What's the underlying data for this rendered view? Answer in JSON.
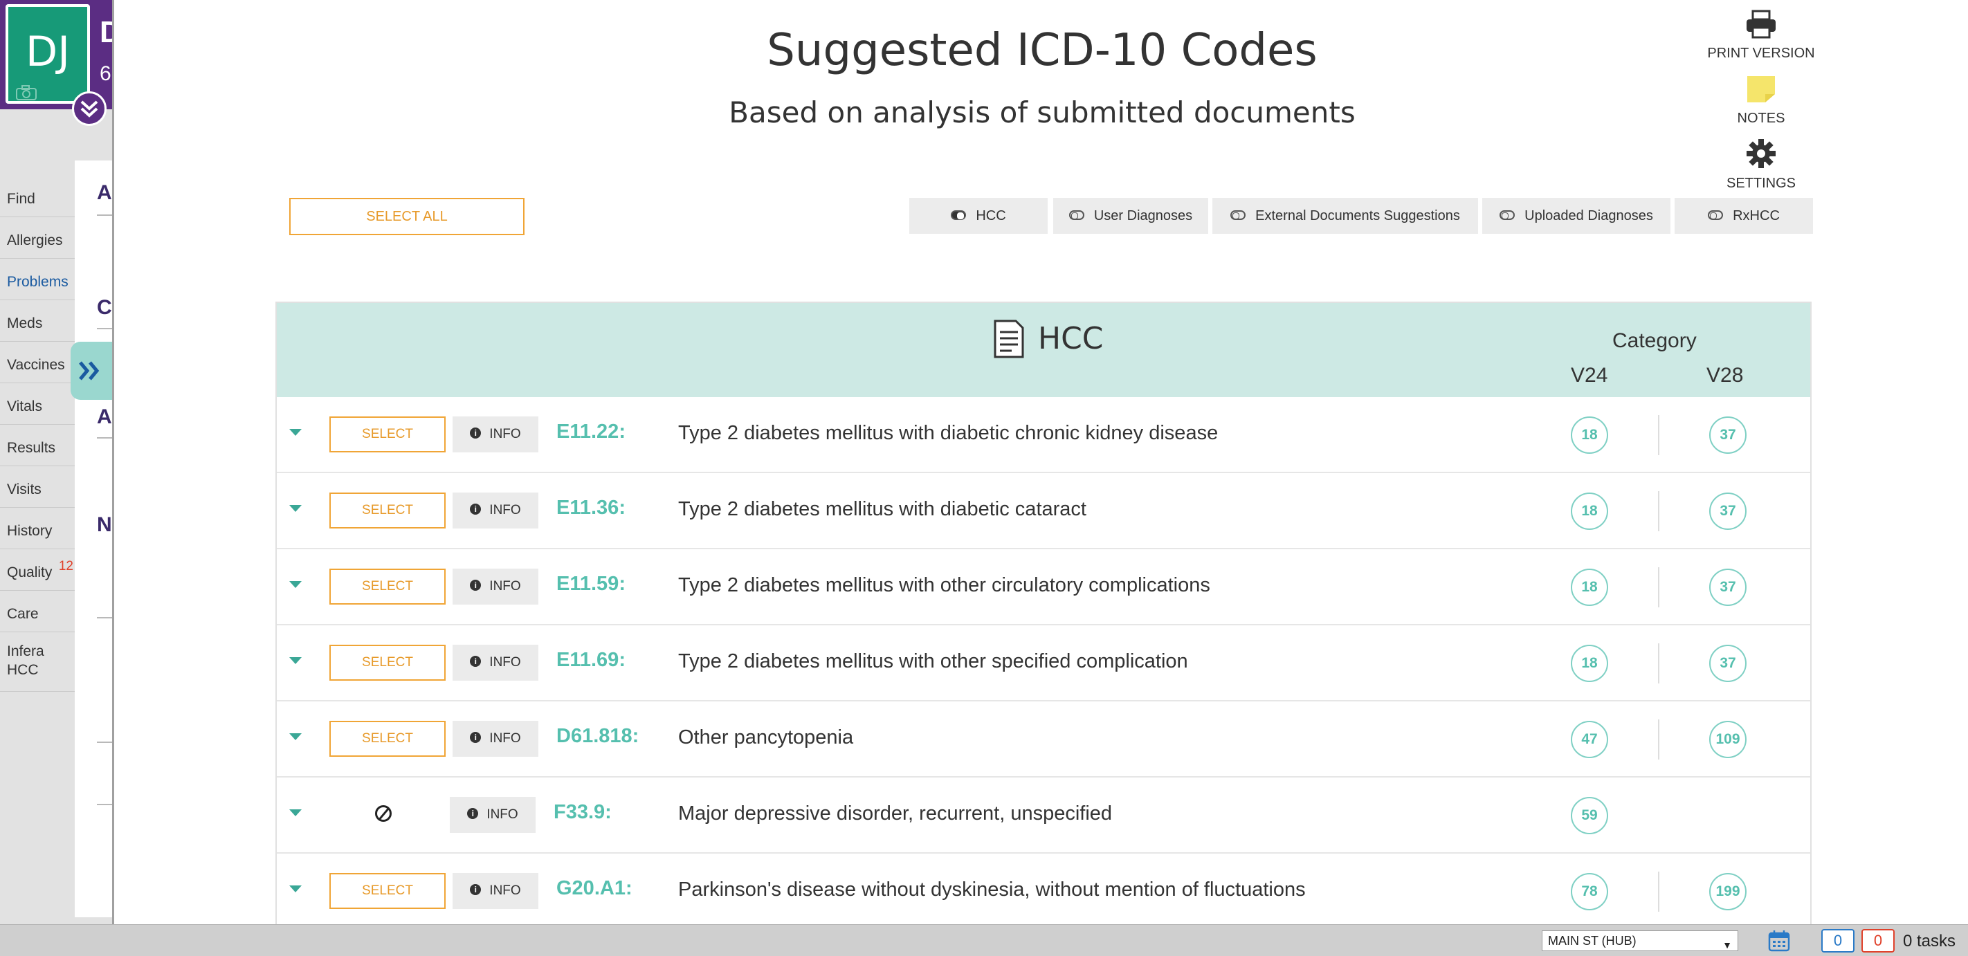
{
  "patient": {
    "initials": "DJ",
    "name_partial": "D",
    "sub_partial": "6"
  },
  "nav": {
    "items": [
      {
        "label": "Find"
      },
      {
        "label": "Allergies"
      },
      {
        "label": "Problems"
      },
      {
        "label": "Meds"
      },
      {
        "label": "Vaccines"
      },
      {
        "label": "Vitals"
      },
      {
        "label": "Results"
      },
      {
        "label": "Visits"
      },
      {
        "label": "History"
      },
      {
        "label": "Quality",
        "badge": "12"
      },
      {
        "label": "Care"
      },
      {
        "label": "Infera HCC"
      }
    ],
    "underlay_glyphs": [
      "A",
      "C",
      "A",
      "N"
    ]
  },
  "panel": {
    "title": "Suggested ICD-10 Codes",
    "subtitle": "Based on analysis of submitted documents",
    "tools": {
      "print": "PRINT VERSION",
      "notes": "NOTES",
      "settings": "SETTINGS"
    },
    "select_all": "SELECT ALL",
    "filters": [
      {
        "label": "HCC",
        "on": true
      },
      {
        "label": "User Diagnoses",
        "on": false
      },
      {
        "label": "External Documents Suggestions",
        "on": false
      },
      {
        "label": "Uploaded Diagnoses",
        "on": false
      },
      {
        "label": "RxHCC",
        "on": false
      }
    ]
  },
  "table": {
    "title": "HCC",
    "category_label": "Category",
    "v24_label": "V24",
    "v28_label": "V28",
    "select_label": "SELECT",
    "info_label": "INFO",
    "rows": [
      {
        "code": "E11.22:",
        "desc": "Type 2 diabetes mellitus with diabetic chronic kidney disease",
        "v24": "18",
        "v28": "37",
        "selectable": true
      },
      {
        "code": "E11.36:",
        "desc": "Type 2 diabetes mellitus with diabetic cataract",
        "v24": "18",
        "v28": "37",
        "selectable": true
      },
      {
        "code": "E11.59:",
        "desc": "Type 2 diabetes mellitus with other circulatory complications",
        "v24": "18",
        "v28": "37",
        "selectable": true
      },
      {
        "code": "E11.69:",
        "desc": "Type 2 diabetes mellitus with other specified complication",
        "v24": "18",
        "v28": "37",
        "selectable": true
      },
      {
        "code": "D61.818:",
        "desc": "Other pancytopenia",
        "v24": "47",
        "v28": "109",
        "selectable": true
      },
      {
        "code": "F33.9:",
        "desc": "Major depressive disorder, recurrent, unspecified",
        "v24": "59",
        "v28": "",
        "selectable": false
      },
      {
        "code": "G20.A1:",
        "desc": "Parkinson's disease without dyskinesia, without mention of fluctuations",
        "v24": "78",
        "v28": "199",
        "selectable": true
      }
    ]
  },
  "status": {
    "location": "MAIN ST (HUB)",
    "count_blue": "0",
    "count_red": "0",
    "tasks": "0 tasks"
  },
  "colors": {
    "accent_teal": "#55bfae",
    "header_teal": "#cde9e4",
    "select_orange": "#f0a536",
    "patient_purple": "#5b2d83",
    "avatar_green": "#179a78",
    "notes_yellow": "#f5e56b"
  },
  "icons": [
    "camera-icon",
    "double-chevron-down-icon",
    "double-chevron-right-icon",
    "printer-icon",
    "sticky-note-icon",
    "gear-icon",
    "toggle-icon",
    "document-icon",
    "chevron-down-icon",
    "info-icon",
    "no-entry-icon",
    "calendar-icon",
    "dropdown-arrow-icon"
  ]
}
